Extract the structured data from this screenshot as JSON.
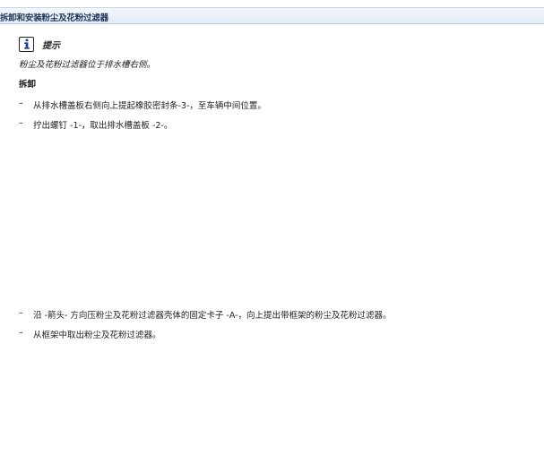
{
  "header": {
    "title": "拆卸和安装粉尘及花粉过滤器"
  },
  "note": {
    "icon": "info-icon",
    "label": "提示",
    "text": "粉尘及花粉过滤器位于排水槽右侧。"
  },
  "section": {
    "heading": "拆卸"
  },
  "steps": [
    {
      "bullet": "–",
      "text": "从排水槽盖板右侧向上提起橡胶密封条-3-，至车辆中间位置。"
    },
    {
      "bullet": "–",
      "text": "拧出螺钉 -1-，取出排水槽盖板 -2-。"
    },
    {
      "bullet": "–",
      "text": "沿 -箭头- 方向压粉尘及花粉过滤器壳体的固定卡子 -A-，向上提出带框架的粉尘及花粉过滤器。"
    },
    {
      "bullet": "–",
      "text": "从框架中取出粉尘及花粉过滤器。"
    }
  ]
}
